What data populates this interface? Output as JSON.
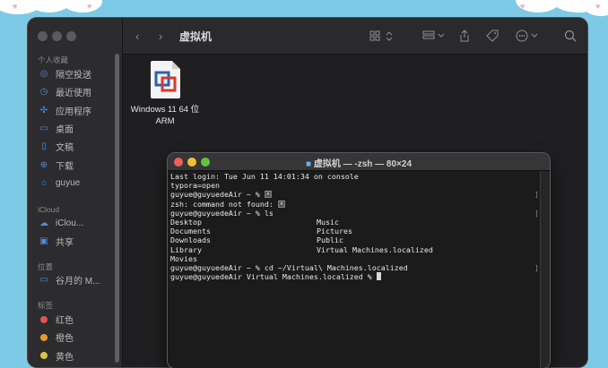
{
  "finder": {
    "title": "虚拟机",
    "sidebar": {
      "favorites_header": "个人收藏",
      "favorites": [
        {
          "label": "隔空投送",
          "icon": "airdrop-icon",
          "glyph": "◎"
        },
        {
          "label": "最近使用",
          "icon": "clock-icon",
          "glyph": "◷"
        },
        {
          "label": "应用程序",
          "icon": "apps-icon",
          "glyph": "✣"
        },
        {
          "label": "桌面",
          "icon": "desktop-icon",
          "glyph": "▭"
        },
        {
          "label": "文稿",
          "icon": "document-icon",
          "glyph": "▯"
        },
        {
          "label": "下载",
          "icon": "download-icon",
          "glyph": "⊕"
        },
        {
          "label": "guyue",
          "icon": "home-icon",
          "glyph": "⌂"
        }
      ],
      "icloud_header": "iCloud",
      "icloud": [
        {
          "label": "iClou...",
          "icon": "cloud-icon",
          "glyph": "☁"
        },
        {
          "label": "共享",
          "icon": "shared-folder-icon",
          "glyph": "▣"
        }
      ],
      "locations_header": "位置",
      "locations": [
        {
          "label": "谷月的 M...",
          "icon": "laptop-icon",
          "glyph": "▭"
        }
      ],
      "tags_header": "标签",
      "tags": [
        {
          "label": "红色",
          "color": "#e0524b"
        },
        {
          "label": "橙色",
          "color": "#e39a2e"
        },
        {
          "label": "黄色",
          "color": "#d8c537"
        }
      ]
    },
    "file": {
      "name_line1": "Windows 11 64 位",
      "name_line2": "ARM"
    }
  },
  "terminal": {
    "title": "虚拟机 — -zsh — 80×24",
    "lines": [
      {
        "a": "Last login: Tue Jun 11 14:01:34 on console",
        "b": "",
        "mark": ""
      },
      {
        "a": "typora=open",
        "b": "",
        "mark": ""
      },
      {
        "a": "guyue@guyuedeAir ~ % 困",
        "b": "",
        "mark": "]"
      },
      {
        "a": "zsh: command not found: 困",
        "b": "",
        "mark": ""
      },
      {
        "a": "guyue@guyuedeAir ~ % ls",
        "b": "",
        "mark": "]"
      },
      {
        "a": "Desktop",
        "b": "Music",
        "mark": ""
      },
      {
        "a": "Documents",
        "b": "Pictures",
        "mark": ""
      },
      {
        "a": "Downloads",
        "b": "Public",
        "mark": ""
      },
      {
        "a": "Library",
        "b": "Virtual Machines.localized",
        "mark": ""
      },
      {
        "a": "Movies",
        "b": "",
        "mark": ""
      },
      {
        "a": "guyue@guyuedeAir ~ % cd ~/Virtual\\ Machines.localized",
        "b": "",
        "mark": "]"
      },
      {
        "a": "guyue@guyuedeAir Virtual Machines.localized % ",
        "b": "",
        "mark": ""
      }
    ]
  }
}
